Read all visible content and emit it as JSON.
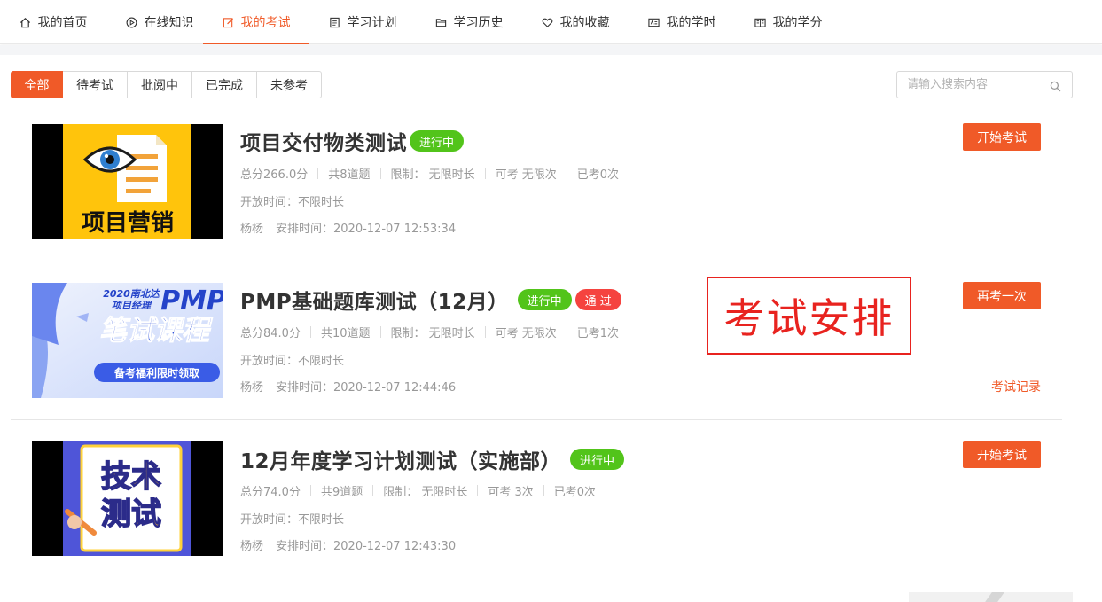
{
  "nav": {
    "items": [
      {
        "label": "我的首页",
        "icon": "home-icon",
        "active": false
      },
      {
        "label": "在线知识",
        "icon": "play-circle-icon",
        "active": false
      },
      {
        "label": "我的考试",
        "icon": "edit-icon",
        "active": true
      },
      {
        "label": "学习计划",
        "icon": "document-list-icon",
        "active": false
      },
      {
        "label": "学习历史",
        "icon": "folder-open-icon",
        "active": false
      },
      {
        "label": "我的收藏",
        "icon": "heart-icon",
        "active": false
      },
      {
        "label": "我的学时",
        "icon": "id-card-icon",
        "active": false
      },
      {
        "label": "我的学分",
        "icon": "book-open-icon",
        "active": false
      }
    ],
    "accent_color": "#f05a28"
  },
  "filters": {
    "tabs": [
      {
        "label": "全部",
        "active": true
      },
      {
        "label": "待考试",
        "active": false
      },
      {
        "label": "批阅中",
        "active": false
      },
      {
        "label": "已完成",
        "active": false
      },
      {
        "label": "未参考",
        "active": false
      }
    ]
  },
  "search": {
    "placeholder": "请输入搜索内容",
    "value": "",
    "icon": "search-icon"
  },
  "annotation": {
    "text": "考试安排",
    "color": "#e8231f"
  },
  "exams": [
    {
      "title": "项目交付物类测试",
      "badges": [
        {
          "text": "进行中",
          "color": "#52c41a"
        }
      ],
      "total_score": "总分266.0分",
      "question_count": "共8道题",
      "time_limit": "限制： 无限时长",
      "attempts_allowed": "可考 无限次",
      "attempts_taken": "已考0次",
      "open_time": "开放时间：不限时长",
      "teacher": "杨杨",
      "schedule_time": "安排时间：2020-12-07 12:53:34",
      "action_label": "开始考试",
      "record_label": "",
      "thumbnail": {
        "text": "项目营销",
        "icon": "eye-document-icon",
        "bg": "#ffc40c"
      }
    },
    {
      "title": "PMP基础题库测试（12月）",
      "badges": [
        {
          "text": "进行中",
          "color": "#52c41a"
        },
        {
          "text": "通 过",
          "color": "#f5433f"
        }
      ],
      "total_score": "总分84.0分",
      "question_count": "共10道题",
      "time_limit": "限制： 无限时长",
      "attempts_allowed": "可考 无限次",
      "attempts_taken": "已考1次",
      "open_time": "开放时间：不限时长",
      "teacher": "杨杨",
      "schedule_time": "安排时间：2020-12-07 12:44:46",
      "action_label": "再考一次",
      "record_label": "考试记录",
      "thumbnail": {
        "line1": "2020南北达",
        "line2": "项目经理",
        "brand": "PMP",
        "headline": "笔试课程",
        "footer": "备考福利限时领取",
        "bg": "#dbe4fb"
      }
    },
    {
      "title": "12月年度学习计划测试（实施部）",
      "badges": [
        {
          "text": "进行中",
          "color": "#52c41a"
        }
      ],
      "total_score": "总分74.0分",
      "question_count": "共9道题",
      "time_limit": "限制： 无限时长",
      "attempts_allowed": "可考 3次",
      "attempts_taken": "已考0次",
      "open_time": "开放时间：不限时长",
      "teacher": "杨杨",
      "schedule_time": "安排时间：2020-12-07 12:43:30",
      "action_label": "开始考试",
      "record_label": "",
      "thumbnail": {
        "line1": "技术",
        "line2": "测试",
        "bg": "#4f55d8"
      }
    }
  ]
}
